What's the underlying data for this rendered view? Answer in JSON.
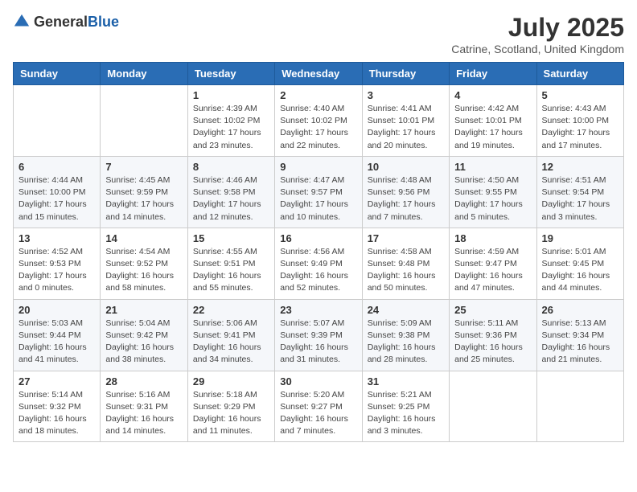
{
  "header": {
    "logo_general": "General",
    "logo_blue": "Blue",
    "month_title": "July 2025",
    "location": "Catrine, Scotland, United Kingdom"
  },
  "days_of_week": [
    "Sunday",
    "Monday",
    "Tuesday",
    "Wednesday",
    "Thursday",
    "Friday",
    "Saturday"
  ],
  "weeks": [
    [
      {
        "day": "",
        "info": ""
      },
      {
        "day": "",
        "info": ""
      },
      {
        "day": "1",
        "info": "Sunrise: 4:39 AM\nSunset: 10:02 PM\nDaylight: 17 hours and 23 minutes."
      },
      {
        "day": "2",
        "info": "Sunrise: 4:40 AM\nSunset: 10:02 PM\nDaylight: 17 hours and 22 minutes."
      },
      {
        "day": "3",
        "info": "Sunrise: 4:41 AM\nSunset: 10:01 PM\nDaylight: 17 hours and 20 minutes."
      },
      {
        "day": "4",
        "info": "Sunrise: 4:42 AM\nSunset: 10:01 PM\nDaylight: 17 hours and 19 minutes."
      },
      {
        "day": "5",
        "info": "Sunrise: 4:43 AM\nSunset: 10:00 PM\nDaylight: 17 hours and 17 minutes."
      }
    ],
    [
      {
        "day": "6",
        "info": "Sunrise: 4:44 AM\nSunset: 10:00 PM\nDaylight: 17 hours and 15 minutes."
      },
      {
        "day": "7",
        "info": "Sunrise: 4:45 AM\nSunset: 9:59 PM\nDaylight: 17 hours and 14 minutes."
      },
      {
        "day": "8",
        "info": "Sunrise: 4:46 AM\nSunset: 9:58 PM\nDaylight: 17 hours and 12 minutes."
      },
      {
        "day": "9",
        "info": "Sunrise: 4:47 AM\nSunset: 9:57 PM\nDaylight: 17 hours and 10 minutes."
      },
      {
        "day": "10",
        "info": "Sunrise: 4:48 AM\nSunset: 9:56 PM\nDaylight: 17 hours and 7 minutes."
      },
      {
        "day": "11",
        "info": "Sunrise: 4:50 AM\nSunset: 9:55 PM\nDaylight: 17 hours and 5 minutes."
      },
      {
        "day": "12",
        "info": "Sunrise: 4:51 AM\nSunset: 9:54 PM\nDaylight: 17 hours and 3 minutes."
      }
    ],
    [
      {
        "day": "13",
        "info": "Sunrise: 4:52 AM\nSunset: 9:53 PM\nDaylight: 17 hours and 0 minutes."
      },
      {
        "day": "14",
        "info": "Sunrise: 4:54 AM\nSunset: 9:52 PM\nDaylight: 16 hours and 58 minutes."
      },
      {
        "day": "15",
        "info": "Sunrise: 4:55 AM\nSunset: 9:51 PM\nDaylight: 16 hours and 55 minutes."
      },
      {
        "day": "16",
        "info": "Sunrise: 4:56 AM\nSunset: 9:49 PM\nDaylight: 16 hours and 52 minutes."
      },
      {
        "day": "17",
        "info": "Sunrise: 4:58 AM\nSunset: 9:48 PM\nDaylight: 16 hours and 50 minutes."
      },
      {
        "day": "18",
        "info": "Sunrise: 4:59 AM\nSunset: 9:47 PM\nDaylight: 16 hours and 47 minutes."
      },
      {
        "day": "19",
        "info": "Sunrise: 5:01 AM\nSunset: 9:45 PM\nDaylight: 16 hours and 44 minutes."
      }
    ],
    [
      {
        "day": "20",
        "info": "Sunrise: 5:03 AM\nSunset: 9:44 PM\nDaylight: 16 hours and 41 minutes."
      },
      {
        "day": "21",
        "info": "Sunrise: 5:04 AM\nSunset: 9:42 PM\nDaylight: 16 hours and 38 minutes."
      },
      {
        "day": "22",
        "info": "Sunrise: 5:06 AM\nSunset: 9:41 PM\nDaylight: 16 hours and 34 minutes."
      },
      {
        "day": "23",
        "info": "Sunrise: 5:07 AM\nSunset: 9:39 PM\nDaylight: 16 hours and 31 minutes."
      },
      {
        "day": "24",
        "info": "Sunrise: 5:09 AM\nSunset: 9:38 PM\nDaylight: 16 hours and 28 minutes."
      },
      {
        "day": "25",
        "info": "Sunrise: 5:11 AM\nSunset: 9:36 PM\nDaylight: 16 hours and 25 minutes."
      },
      {
        "day": "26",
        "info": "Sunrise: 5:13 AM\nSunset: 9:34 PM\nDaylight: 16 hours and 21 minutes."
      }
    ],
    [
      {
        "day": "27",
        "info": "Sunrise: 5:14 AM\nSunset: 9:32 PM\nDaylight: 16 hours and 18 minutes."
      },
      {
        "day": "28",
        "info": "Sunrise: 5:16 AM\nSunset: 9:31 PM\nDaylight: 16 hours and 14 minutes."
      },
      {
        "day": "29",
        "info": "Sunrise: 5:18 AM\nSunset: 9:29 PM\nDaylight: 16 hours and 11 minutes."
      },
      {
        "day": "30",
        "info": "Sunrise: 5:20 AM\nSunset: 9:27 PM\nDaylight: 16 hours and 7 minutes."
      },
      {
        "day": "31",
        "info": "Sunrise: 5:21 AM\nSunset: 9:25 PM\nDaylight: 16 hours and 3 minutes."
      },
      {
        "day": "",
        "info": ""
      },
      {
        "day": "",
        "info": ""
      }
    ]
  ]
}
